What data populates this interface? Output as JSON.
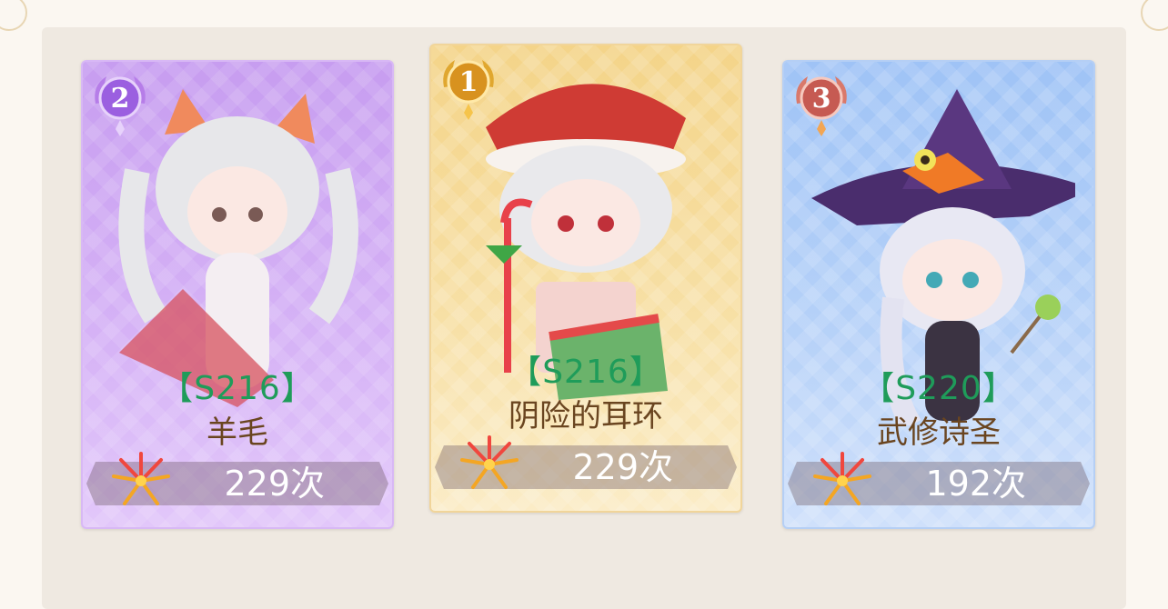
{
  "players": [
    {
      "rank": "2",
      "server": "【S216】",
      "name": "羊毛",
      "count": "229次",
      "theme": "purple"
    },
    {
      "rank": "1",
      "server": "【S216】",
      "name": "阴险的耳环",
      "count": "229次",
      "theme": "gold"
    },
    {
      "rank": "3",
      "server": "【S220】",
      "name": "武修诗圣",
      "count": "192次",
      "theme": "blue"
    }
  ],
  "colors": {
    "server_text": "#1f9c5a",
    "name_text": "#6a4520"
  }
}
